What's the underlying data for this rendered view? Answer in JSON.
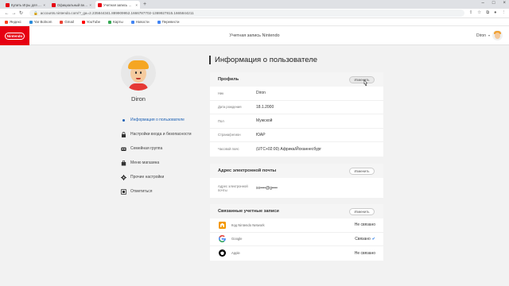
{
  "browser": {
    "tabs": [
      {
        "label": "Купить Игры для Nintendo Swit",
        "close": "×",
        "color": "#e60012",
        "active": false
      },
      {
        "label": "Официальный веб-сайт Ninten",
        "close": "×",
        "color": "#e60012",
        "active": false
      },
      {
        "label": "Учетная запись Nintendo",
        "close": "×",
        "color": "#e60012",
        "active": true
      }
    ],
    "new_tab": "+",
    "window_controls": [
      "–",
      "□",
      "×"
    ],
    "url": "accounts.nintendo.com/?_ga=2.235844341.889909952.1666787702-1369927815.1665844211",
    "bookmarks": [
      {
        "label": "Яндекс",
        "color": "#fc3f1d"
      },
      {
        "label": "Yar Bolnom",
        "color": "#2a8cdb"
      },
      {
        "label": "Gmail",
        "color": "#ea4335"
      },
      {
        "label": "YouTube",
        "color": "#ff0000"
      },
      {
        "label": "Карты",
        "color": "#34a853"
      },
      {
        "label": "Новости",
        "color": "#4285f4"
      },
      {
        "label": "Перевести",
        "color": "#4285f4"
      }
    ]
  },
  "header": {
    "logo_text": "Nintendo",
    "title": "Учетная запись Nintendo",
    "user_name": "Diron"
  },
  "sidebar": {
    "user_name": "Diron",
    "items": [
      {
        "label": "Информация о пользователе",
        "active": true
      },
      {
        "label": "Настройки входа и безопасности",
        "active": false
      },
      {
        "label": "Семейная группа",
        "active": false
      },
      {
        "label": "Меню магазина",
        "active": false
      },
      {
        "label": "Прочие настройки",
        "active": false
      },
      {
        "label": "Отметиться",
        "active": false
      }
    ]
  },
  "main": {
    "title": "Информация о пользователе",
    "profile": {
      "title": "Профиль",
      "button": "Изменить",
      "fields": [
        {
          "label": "Ник",
          "value": "Diron"
        },
        {
          "label": "Дата рождения",
          "value": "18.1.2000"
        },
        {
          "label": "Пол",
          "value": "Мужской"
        },
        {
          "label": "Страна/регион",
          "value": "ЮАР"
        },
        {
          "label": "Часовой пояс",
          "value": "(UTC+02:00) Африка/Йоханнесбург"
        }
      ]
    },
    "email": {
      "title": "Адрес электронной почты",
      "button": "Изменить",
      "field_label": "Адрес электронной почты",
      "value": "xx••••@g••••"
    },
    "linked": {
      "title": "Связанные учетные записи",
      "button": "Изменить",
      "accounts": [
        {
          "name": "Код Nintendo Network",
          "status": "Не связано",
          "linked": false,
          "icon": "nintendo-network-icon"
        },
        {
          "name": "Google",
          "status": "Связано",
          "linked": true,
          "icon": "google-icon"
        },
        {
          "name": "Apple",
          "status": "Не связано",
          "linked": false,
          "icon": "apple-icon"
        }
      ]
    }
  }
}
